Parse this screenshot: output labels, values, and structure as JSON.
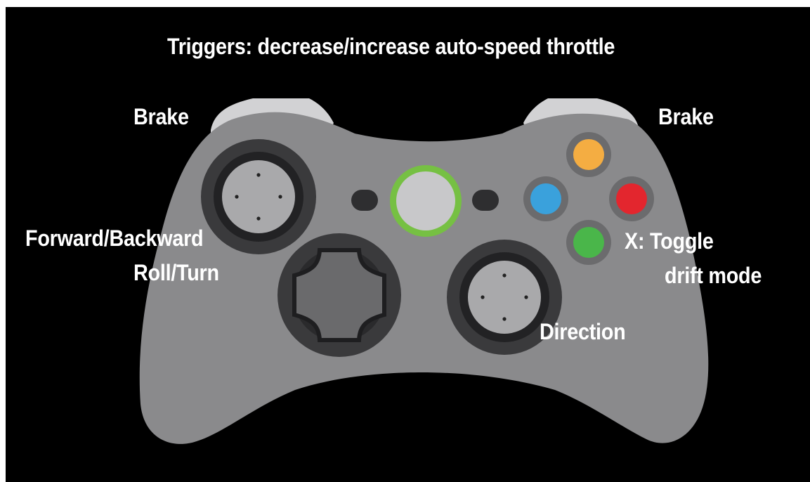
{
  "labels": {
    "title": "Triggers: decrease/increase auto-speed throttle",
    "brake_left": "Brake",
    "brake_right": "Brake",
    "forward_backward": "Forward/Backward",
    "roll_turn": "Roll/Turn",
    "x_toggle": "X: Toggle",
    "drift_mode": "drift mode",
    "direction": "Direction"
  },
  "colors": {
    "background": "#000000",
    "body": "#8a8a8c",
    "bumper": "#d2d2d4",
    "stick_ring": "#3a3a3c",
    "stick_cap": "#a9a9ab",
    "guide_ring": "#76c043",
    "guide_center": "#c8c8ca",
    "button_y": "#f4ad42",
    "button_x": "#3aa1dc",
    "button_b": "#e3262e",
    "button_a": "#4ab64a"
  },
  "icons": [
    "controller-body",
    "left-bumper-icon",
    "right-bumper-icon",
    "left-stick-icon",
    "right-stick-icon",
    "dpad-icon",
    "guide-button-icon",
    "back-button-icon",
    "start-button-icon",
    "y-button-icon",
    "x-button-icon",
    "b-button-icon",
    "a-button-icon"
  ]
}
